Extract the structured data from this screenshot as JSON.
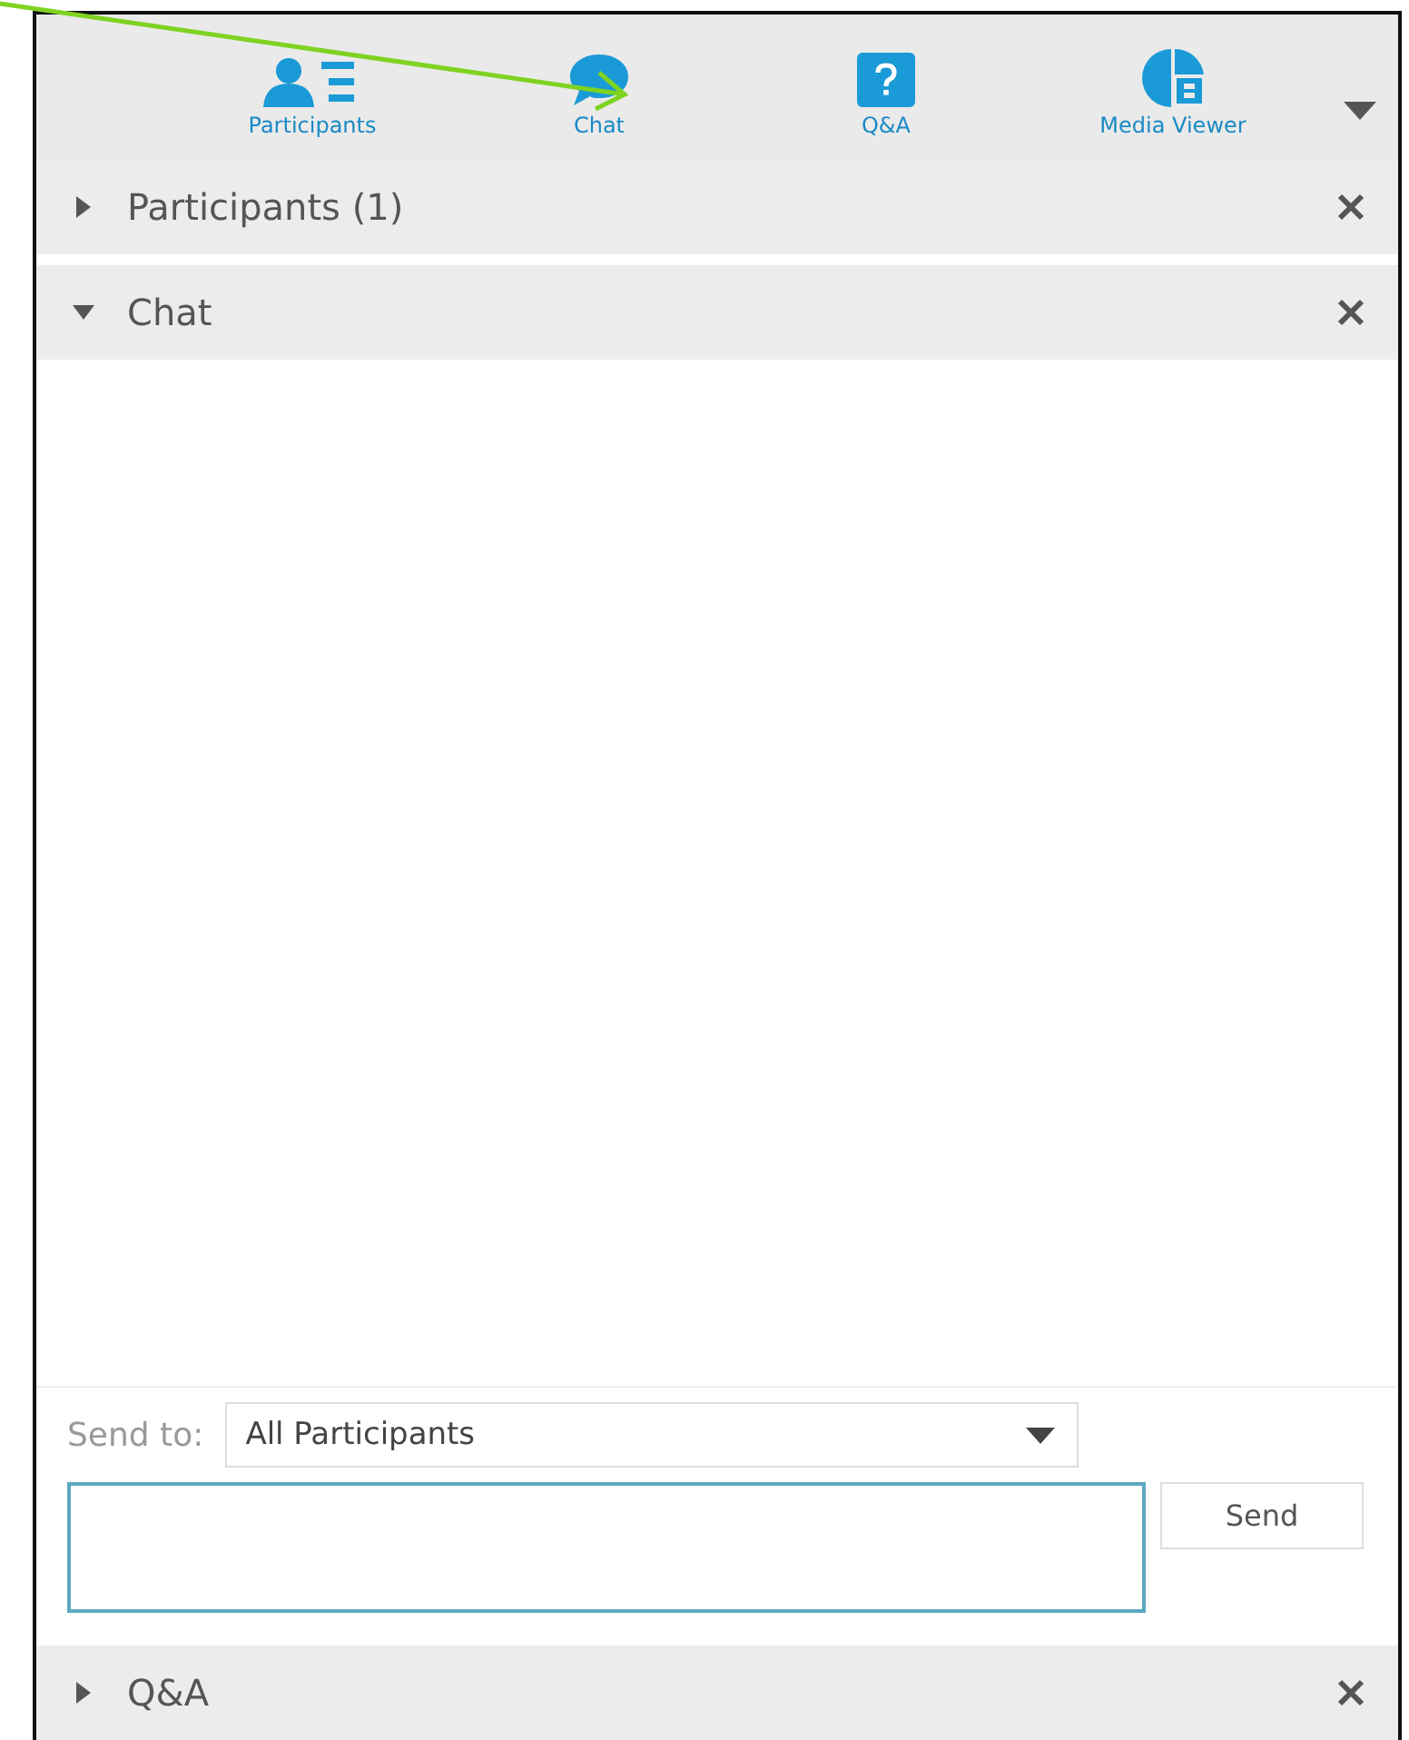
{
  "toolbar": {
    "items": [
      {
        "kind": "people",
        "label": "Participants"
      },
      {
        "kind": "chat",
        "label": "Chat"
      },
      {
        "kind": "question",
        "label": "Q&A"
      },
      {
        "kind": "media",
        "label": "Media Viewer"
      }
    ]
  },
  "panels": [
    {
      "title": "Participants (1)",
      "expanded": false
    },
    {
      "title": "Chat",
      "expanded": true,
      "send_to_label": "Send to:",
      "recipient": "All Participants",
      "send_button": "Send"
    },
    {
      "title": "Q&A",
      "expanded": false
    }
  ]
}
